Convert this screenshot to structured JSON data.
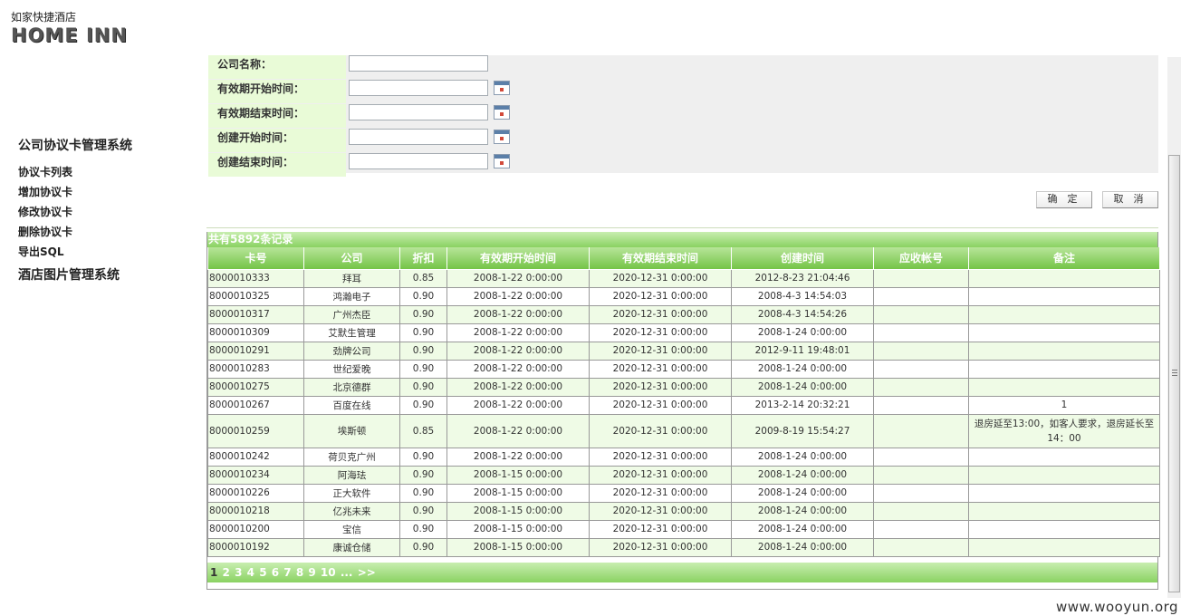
{
  "logo": {
    "sub": "如家快捷酒店",
    "main": "HOME INN"
  },
  "sidebar": {
    "title": "公司协议卡管理系统",
    "links": [
      "协议卡列表",
      "增加协议卡",
      "修改协议卡",
      "删除协议卡",
      "导出SQL"
    ],
    "title2": "酒店图片管理系统"
  },
  "form": {
    "fields": [
      {
        "label": "公司名称：",
        "calendar": false
      },
      {
        "label": "有效期开始时间：",
        "calendar": true
      },
      {
        "label": "有效期结束时间：",
        "calendar": true
      },
      {
        "label": "创建开始时间：",
        "calendar": true
      },
      {
        "label": "创建结束时间：",
        "calendar": true
      }
    ],
    "confirm": "确 定",
    "cancel": "取 消"
  },
  "grid": {
    "summary": "共有5892条记录",
    "columns": [
      "卡号",
      "公司",
      "折扣",
      "有效期开始时间",
      "有效期结束时间",
      "创建时间",
      "应收帐号",
      "备注"
    ],
    "rows": [
      [
        "8000010333",
        "拜耳",
        "0.85",
        "2008-1-22 0:00:00",
        "2020-12-31 0:00:00",
        "2012-8-23 21:04:46",
        "",
        ""
      ],
      [
        "8000010325",
        "鸿瀚电子",
        "0.90",
        "2008-1-22 0:00:00",
        "2020-12-31 0:00:00",
        "2008-4-3 14:54:03",
        "",
        ""
      ],
      [
        "8000010317",
        "广州杰臣",
        "0.90",
        "2008-1-22 0:00:00",
        "2020-12-31 0:00:00",
        "2008-4-3 14:54:26",
        "",
        ""
      ],
      [
        "8000010309",
        "艾默生管理",
        "0.90",
        "2008-1-22 0:00:00",
        "2020-12-31 0:00:00",
        "2008-1-24 0:00:00",
        "",
        ""
      ],
      [
        "8000010291",
        "劲牌公司",
        "0.90",
        "2008-1-22 0:00:00",
        "2020-12-31 0:00:00",
        "2012-9-11 19:48:01",
        "",
        ""
      ],
      [
        "8000010283",
        "世纪爱晚",
        "0.90",
        "2008-1-22 0:00:00",
        "2020-12-31 0:00:00",
        "2008-1-24 0:00:00",
        "",
        ""
      ],
      [
        "8000010275",
        "北京德群",
        "0.90",
        "2008-1-22 0:00:00",
        "2020-12-31 0:00:00",
        "2008-1-24 0:00:00",
        "",
        ""
      ],
      [
        "8000010267",
        "百度在线",
        "0.90",
        "2008-1-22 0:00:00",
        "2020-12-31 0:00:00",
        "2013-2-14 20:32:21",
        "",
        "1"
      ],
      [
        "8000010259",
        "埃斯顿",
        "0.85",
        "2008-1-22 0:00:00",
        "2020-12-31 0:00:00",
        "2009-8-19 15:54:27",
        "",
        "退房延至13:00，如客人要求，退房延长至14：00"
      ],
      [
        "8000010242",
        "荷贝克广州",
        "0.90",
        "2008-1-22 0:00:00",
        "2020-12-31 0:00:00",
        "2008-1-24 0:00:00",
        "",
        ""
      ],
      [
        "8000010234",
        "阿海珐",
        "0.90",
        "2008-1-15 0:00:00",
        "2020-12-31 0:00:00",
        "2008-1-24 0:00:00",
        "",
        ""
      ],
      [
        "8000010226",
        "正大软件",
        "0.90",
        "2008-1-15 0:00:00",
        "2020-12-31 0:00:00",
        "2008-1-24 0:00:00",
        "",
        ""
      ],
      [
        "8000010218",
        "亿兆未来",
        "0.90",
        "2008-1-15 0:00:00",
        "2020-12-31 0:00:00",
        "2008-1-24 0:00:00",
        "",
        ""
      ],
      [
        "8000010200",
        "宝信",
        "0.90",
        "2008-1-15 0:00:00",
        "2020-12-31 0:00:00",
        "2008-1-24 0:00:00",
        "",
        ""
      ],
      [
        "8000010192",
        "康诚仓储",
        "0.90",
        "2008-1-15 0:00:00",
        "2020-12-31 0:00:00",
        "2008-1-24 0:00:00",
        "",
        ""
      ]
    ],
    "pager": {
      "current": "1",
      "pages": [
        "2",
        "3",
        "4",
        "5",
        "6",
        "7",
        "8",
        "9",
        "10"
      ],
      "more": "...",
      "next": ">>"
    }
  },
  "watermark": "www.wooyun.org"
}
